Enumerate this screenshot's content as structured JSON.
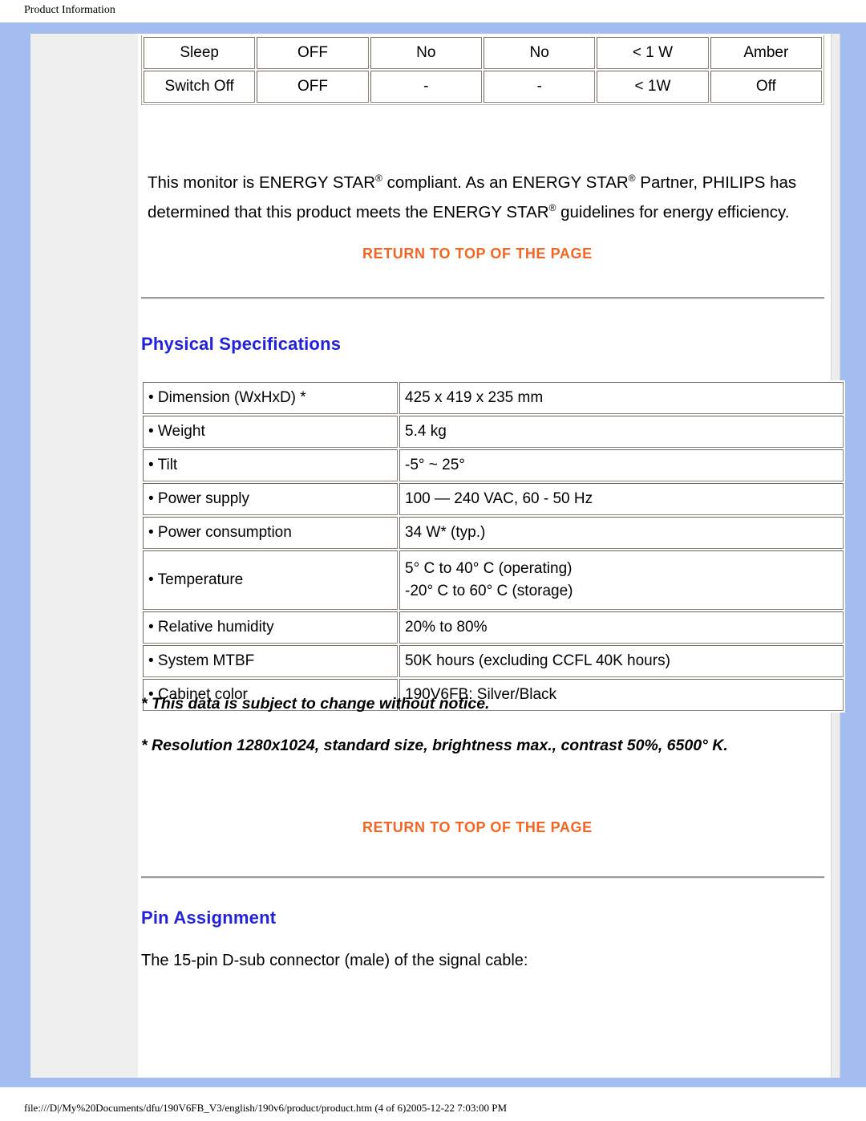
{
  "page": {
    "header_title": "Product Information",
    "footer_path": "file:///D|/My%20Documents/dfu/190V6FB_V3/english/190v6/product/product.htm (4 of 6)2005-12-22 7:03:00 PM"
  },
  "colors": {
    "frame_blue": "#a3bdf0",
    "link_orange": "#f26522",
    "heading_blue": "#2222dd",
    "sidebar_grey": "#efefef"
  },
  "power_management_table": {
    "rows": [
      [
        "Sleep",
        "OFF",
        "No",
        "No",
        "< 1 W",
        "Amber"
      ],
      [
        "Switch Off",
        "OFF",
        "-",
        "-",
        "< 1W",
        "Off"
      ]
    ]
  },
  "energy_star": {
    "part1": "This monitor is ENERGY STAR",
    "reg1": "®",
    "part2": " compliant. As an ENERGY STAR",
    "reg2": "®",
    "part3": " Partner, PHILIPS has determined that this product meets the ENERGY STAR",
    "reg3": "®",
    "part4": " guidelines for energy efficiency."
  },
  "return_to_top": {
    "label": "RETURN TO TOP OF THE PAGE"
  },
  "physical_specifications": {
    "title": "Physical Specifications",
    "rows": [
      {
        "label": "• Dimension (WxHxD) *",
        "value": "425 x 419 x 235 mm"
      },
      {
        "label": "• Weight",
        "value": "5.4 kg"
      },
      {
        "label": "• Tilt",
        "value": "-5° ~ 25°"
      },
      {
        "label": "• Power supply",
        "value": "100 — 240 VAC, 60 - 50 Hz"
      },
      {
        "label": "• Power consumption",
        "value": "34 W* (typ.)"
      },
      {
        "label": "• Temperature",
        "value": "5° C to 40° C (operating)\n-20° C to 60° C (storage)"
      },
      {
        "label": "• Relative humidity",
        "value": "20% to 80%"
      },
      {
        "label": "• System MTBF",
        "value": "50K hours (excluding CCFL 40K hours)"
      },
      {
        "label": "• Cabinet color",
        "value": "190V6FB: Silver/Black"
      }
    ],
    "footnotes": [
      "* This data is subject to change without notice.",
      "* Resolution 1280x1024, standard size, brightness max., contrast 50%, 6500° K."
    ]
  },
  "pin_assignment": {
    "title": "Pin Assignment",
    "body": "The 15-pin D-sub connector (male) of the signal cable:"
  }
}
